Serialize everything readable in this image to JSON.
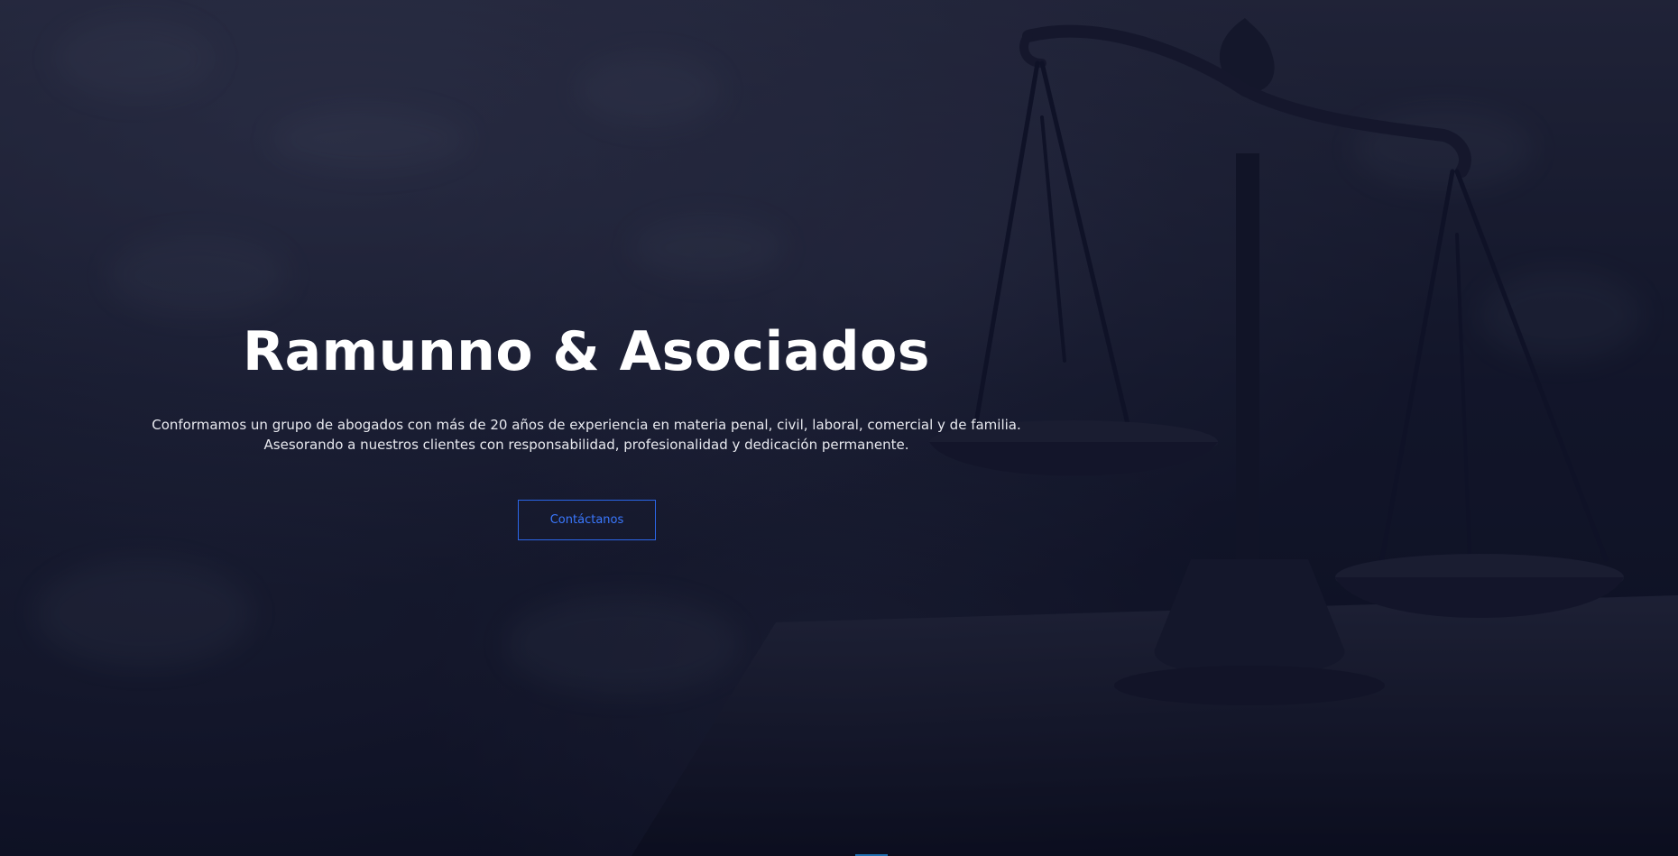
{
  "hero": {
    "title": "Ramunno & Asociados",
    "description_line1": "Conformamos un grupo de abogados con más de 20 años de experiencia en materia penal, civil, laboral, comercial y de familia.",
    "description_line2": "Asesorando a nuestros clientes con responsabilidad, profesionalidad y dedicación permanente.",
    "cta_label": "Contáctanos",
    "background_image": "scales-of-justice",
    "colors": {
      "overlay": "#0c0e22",
      "title": "#ffffff",
      "text": "#e8e9ef",
      "accent": "#2b66e8"
    }
  }
}
